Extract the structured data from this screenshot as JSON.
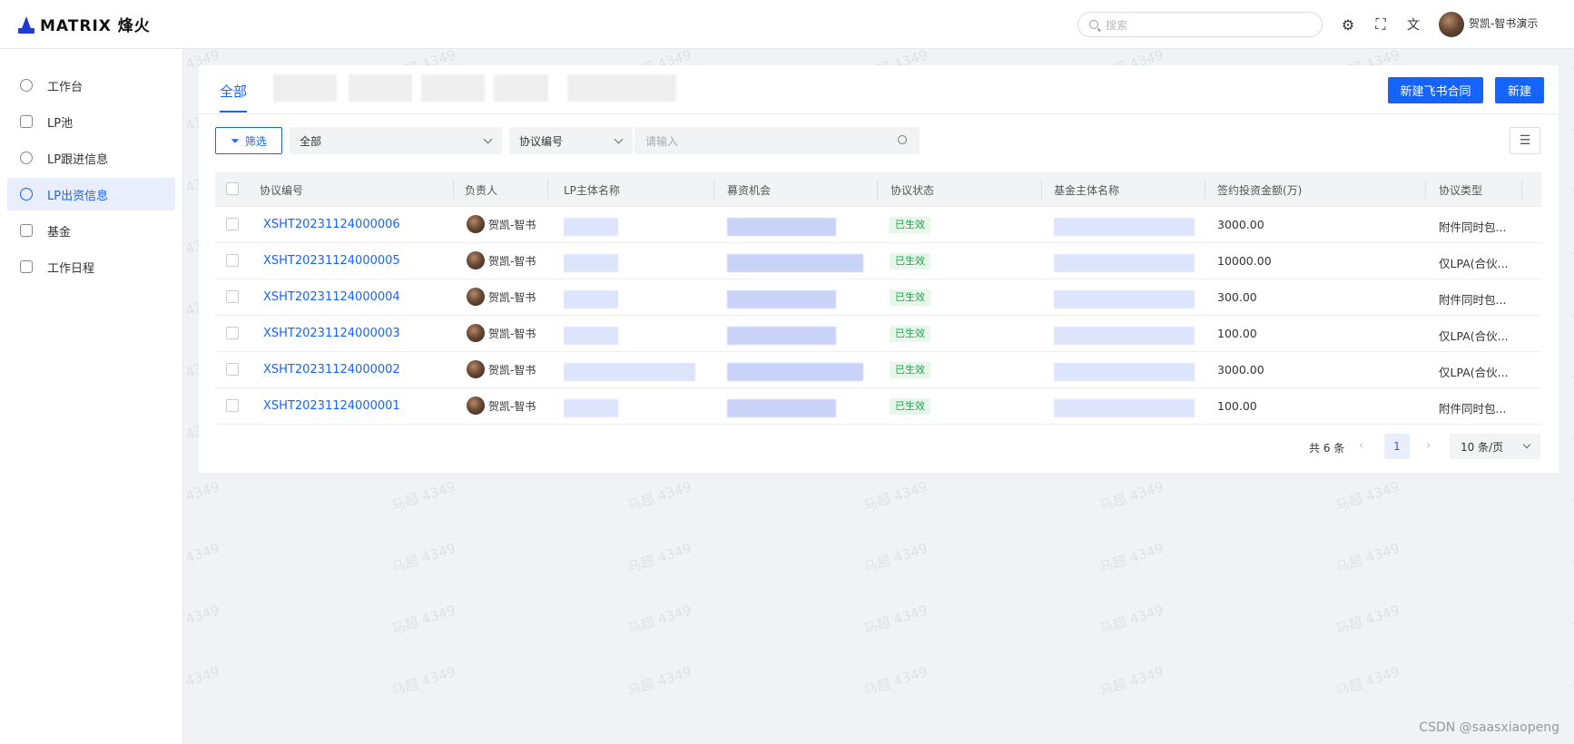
{
  "app": {
    "logo_text": "MATRIX 烽火"
  },
  "header": {
    "search_placeholder": "搜索",
    "user_name": "贺凯-智书演示",
    "icons": [
      "gear-icon",
      "fullscreen-icon",
      "translate-icon"
    ]
  },
  "sidebar": {
    "items": [
      {
        "label": "工作台",
        "icon": "dashboard-icon",
        "active": false
      },
      {
        "label": "LP池",
        "icon": "pool-icon",
        "active": false
      },
      {
        "label": "LP跟进信息",
        "icon": "follow-icon",
        "active": false
      },
      {
        "label": "LP出资信息",
        "icon": "funding-icon",
        "active": true
      },
      {
        "label": "基金",
        "icon": "fund-icon",
        "active": false
      },
      {
        "label": "工作日程",
        "icon": "calendar-icon",
        "active": false
      }
    ]
  },
  "tabs": {
    "active_label": "全部"
  },
  "actions": {
    "new_feishu_contract": "新建飞书合同",
    "new": "新建"
  },
  "filters": {
    "filter_button": "筛选",
    "scope_select": "全部",
    "field_select": "协议编号",
    "input_placeholder": "请输入"
  },
  "table": {
    "columns": [
      "协议编号",
      "负责人",
      "LP主体名称",
      "募资机会",
      "协议状态",
      "基金主体名称",
      "签约投资金额(万)",
      "协议类型"
    ],
    "rows": [
      {
        "id": "XSHT20231124000006",
        "owner": "贺凯-智书",
        "status": "已生效",
        "amount": "3000.00",
        "type": "附件同时包..."
      },
      {
        "id": "XSHT20231124000005",
        "owner": "贺凯-智书",
        "status": "已生效",
        "amount": "10000.00",
        "type": "仅LPA(合伙..."
      },
      {
        "id": "XSHT20231124000004",
        "owner": "贺凯-智书",
        "status": "已生效",
        "amount": "300.00",
        "type": "附件同时包..."
      },
      {
        "id": "XSHT20231124000003",
        "owner": "贺凯-智书",
        "status": "已生效",
        "amount": "100.00",
        "type": "仅LPA(合伙..."
      },
      {
        "id": "XSHT20231124000002",
        "owner": "贺凯-智书",
        "status": "已生效",
        "amount": "3000.00",
        "type": "仅LPA(合伙..."
      },
      {
        "id": "XSHT20231124000001",
        "owner": "贺凯-智书",
        "status": "已生效",
        "amount": "100.00",
        "type": "附件同时包..."
      }
    ]
  },
  "pagination": {
    "total": "共 6 条",
    "current_page": "1",
    "page_size": "10 条/页"
  },
  "watermark": "马超 4349",
  "credit": "CSDN @saasxiaopeng",
  "colors": {
    "primary": "#1664ff",
    "success": "#22a34c",
    "background": "#f0f2f5"
  }
}
